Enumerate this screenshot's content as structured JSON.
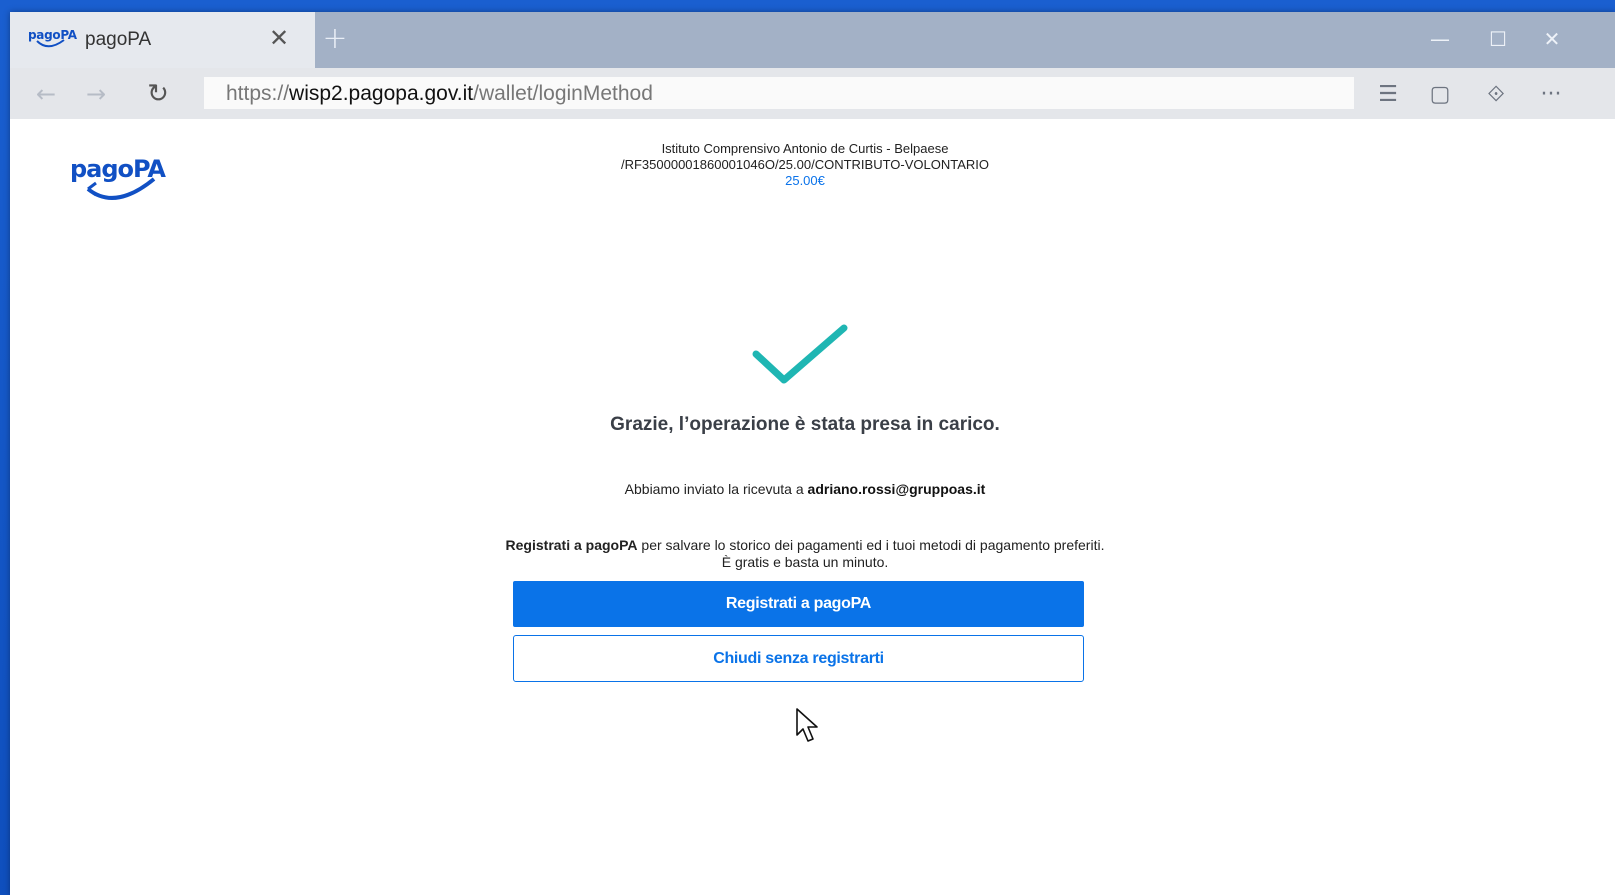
{
  "browser": {
    "tab": {
      "favicon_text": "pagoPA",
      "title": "pagoPA",
      "close_glyph": "✕"
    },
    "new_tab_glyph": "+",
    "window_controls": {
      "minimize": "—",
      "maximize": "☐",
      "close": "✕"
    },
    "nav": {
      "back": "←",
      "forward": "→",
      "refresh": "↻"
    },
    "url": {
      "scheme": "https://",
      "host": "wisp2.pagopa.gov.it",
      "path": "/wallet/loginMethod"
    },
    "tools": {
      "hub": "☰",
      "notes": "▢",
      "share": "⟐",
      "more": "···"
    }
  },
  "page": {
    "logo_text": "pagoPA",
    "header": {
      "institution": "Istituto Comprensivo Antonio de Curtis - Belpaese",
      "reference": "/RF35000001860001046O/25.00/CONTRIBUTO-VOLONTARIO",
      "amount": "25.00€"
    },
    "status_icon": "checkmark-icon",
    "thanks_message": "Grazie, l’operazione è stata presa in carico.",
    "receipt_prefix": "Abbiamo inviato la ricevuta a ",
    "receipt_email": "adriano.rossi@gruppoas.it",
    "register_bold": "Registrati a pagoPA",
    "register_rest": " per salvare lo storico dei pagamenti ed i tuoi metodi di pagamento preferiti.",
    "register_line2": "È gratis e basta un minuto.",
    "buttons": {
      "register": "Registrati a pagoPA",
      "close": "Chiudi senza registrarti"
    }
  },
  "colors": {
    "accent": "#0a73e8",
    "check": "#1fb6b3",
    "desktop": "#1257c9"
  }
}
